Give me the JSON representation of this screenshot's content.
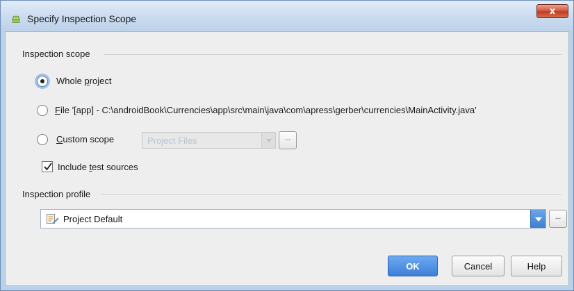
{
  "window": {
    "title": "Specify Inspection Scope",
    "close_glyph": "x"
  },
  "scope_section": {
    "heading": "Inspection scope",
    "options": [
      {
        "prefix": "Whole ",
        "mnemonic": "p",
        "suffix": "roject",
        "selected": true
      },
      {
        "prefix": "",
        "mnemonic": "F",
        "suffix": "ile '[app] - C:\\androidBook\\Currencies\\app\\src\\main\\java\\com\\apress\\gerber\\currencies\\MainActivity.java'",
        "selected": false
      },
      {
        "prefix": "",
        "mnemonic": "C",
        "suffix": "ustom scope",
        "selected": false
      }
    ],
    "custom_scope_select": {
      "value": "Project Files",
      "enabled": false
    },
    "custom_scope_browse": "...",
    "include_test_sources": {
      "prefix": "Include ",
      "mnemonic": "t",
      "suffix": "est sources",
      "checked": true
    }
  },
  "profile_section": {
    "heading": "Inspection profile",
    "selected_profile": "Project Default",
    "browse": "..."
  },
  "buttons": {
    "ok": "OK",
    "cancel": "Cancel",
    "help": "Help"
  },
  "colors": {
    "accent": "#3b7fd8",
    "title_bar": "#c9dbef",
    "close": "#c23a20"
  },
  "icons": {
    "app": "android-icon",
    "close": "close-icon",
    "profile": "inspection-profile-icon",
    "dropdown": "chevron-down-icon",
    "checkmark": "checkmark-icon"
  }
}
